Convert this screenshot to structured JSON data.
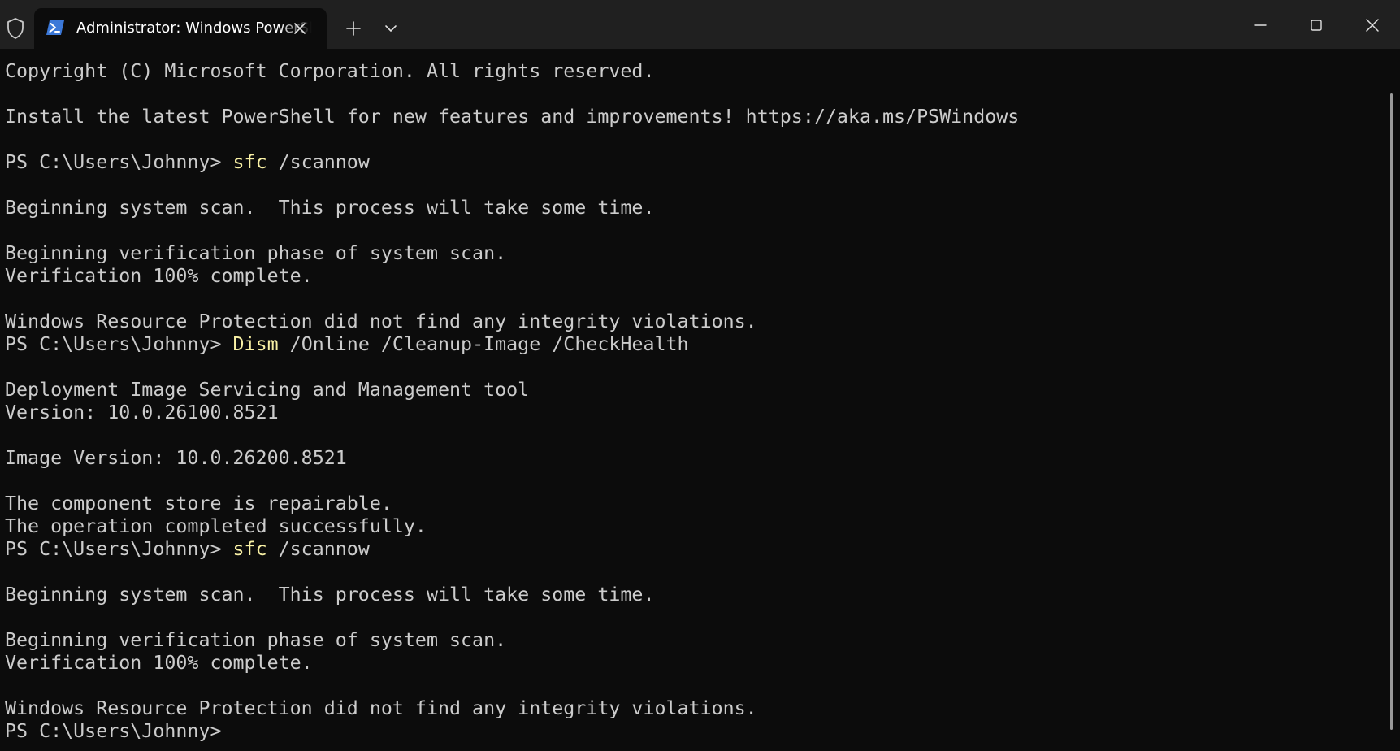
{
  "window": {
    "tab_title": "Administrator: Windows PowerShell",
    "tab_icon": "powershell-icon",
    "shield_icon": "shield-icon",
    "new_tab_icon": "plus-icon",
    "dropdown_icon": "chevron-down-icon",
    "minimize_icon": "minimize-icon",
    "maximize_icon": "maximize-icon",
    "close_icon": "close-icon"
  },
  "colors": {
    "background": "#0c0c0c",
    "titlebar": "#202020",
    "text": "#cccccc",
    "command_highlight": "#f9f1a5",
    "powershell_icon": "#3b78d8"
  },
  "terminal": {
    "lines": [
      {
        "text": "Copyright (C) Microsoft Corporation. All rights reserved."
      },
      {
        "text": "Install the latest PowerShell for new features and improvements! https://aka.ms/PSWindows"
      },
      {
        "prompt": "PS C:\\Users\\Johnny> ",
        "command": "sfc",
        "args": " /scannow"
      },
      {
        "text": "Beginning system scan.  This process will take some time."
      },
      {
        "text": "Beginning verification phase of system scan."
      },
      {
        "text": "Verification 100% complete."
      },
      {
        "text": "Windows Resource Protection did not find any integrity violations."
      },
      {
        "prompt": "PS C:\\Users\\Johnny> ",
        "command": "Dism",
        "args": " /Online /Cleanup-Image /CheckHealth"
      },
      {
        "text": "Deployment Image Servicing and Management tool"
      },
      {
        "text": "Version: 10.0.26100.8521"
      },
      {
        "text": "Image Version: 10.0.26200.8521"
      },
      {
        "text": "The component store is repairable."
      },
      {
        "text": "The operation completed successfully."
      },
      {
        "prompt": "PS C:\\Users\\Johnny> ",
        "command": "sfc",
        "args": " /scannow"
      },
      {
        "text": "Beginning system scan.  This process will take some time."
      },
      {
        "text": "Beginning verification phase of system scan."
      },
      {
        "text": "Verification 100% complete."
      },
      {
        "text": "Windows Resource Protection did not find any integrity violations."
      },
      {
        "prompt": "PS C:\\Users\\Johnny> "
      }
    ]
  }
}
